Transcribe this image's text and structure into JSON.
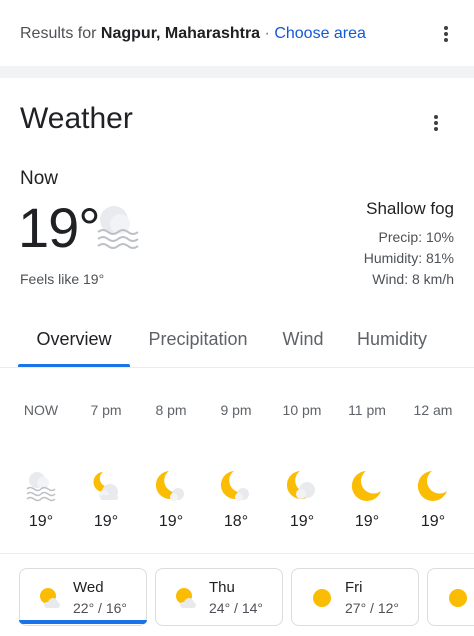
{
  "results": {
    "prefix": "Results for",
    "location": "Nagpur, Maharashtra",
    "separator": "·",
    "choose_area": "Choose area"
  },
  "weather": {
    "title": "Weather",
    "now_label": "Now",
    "temperature": "19°",
    "feels_like": "Feels like 19°",
    "condition": "Shallow fog",
    "precip": "Precip: 10%",
    "humidity": "Humidity: 81%",
    "wind": "Wind: 8 km/h",
    "current_icon": "fog-icon"
  },
  "tabs": [
    {
      "label": "Overview",
      "selected": true
    },
    {
      "label": "Precipitation",
      "selected": false
    },
    {
      "label": "Wind",
      "selected": false
    },
    {
      "label": "Humidity",
      "selected": false
    }
  ],
  "hourly": [
    {
      "time": "NOW",
      "temp": "19°",
      "icon": "fog-icon"
    },
    {
      "time": "7 pm",
      "temp": "19°",
      "icon": "partly-cloudy-night-icon"
    },
    {
      "time": "8 pm",
      "temp": "19°",
      "icon": "partly-cloudy-night-icon"
    },
    {
      "time": "9 pm",
      "temp": "18°",
      "icon": "partly-cloudy-night-icon"
    },
    {
      "time": "10 pm",
      "temp": "19°",
      "icon": "partly-cloudy-night-icon"
    },
    {
      "time": "11 pm",
      "temp": "19°",
      "icon": "clear-night-icon"
    },
    {
      "time": "12 am",
      "temp": "19°",
      "icon": "clear-night-icon"
    }
  ],
  "daily": [
    {
      "day": "Wed",
      "range": "22° / 16°",
      "icon": "partly-cloudy-day-icon",
      "selected": true
    },
    {
      "day": "Thu",
      "range": "24° / 14°",
      "icon": "partly-cloudy-day-icon",
      "selected": false
    },
    {
      "day": "Fri",
      "range": "27° / 12°",
      "icon": "sunny-icon",
      "selected": false
    },
    {
      "day": "",
      "range": "",
      "icon": "sunny-icon",
      "selected": false
    }
  ],
  "colors": {
    "accent": "#1a73e8",
    "link": "#1558d6",
    "sun": "#fbbc04",
    "moon": "#fbbc04",
    "cloud": "#dadce0"
  }
}
